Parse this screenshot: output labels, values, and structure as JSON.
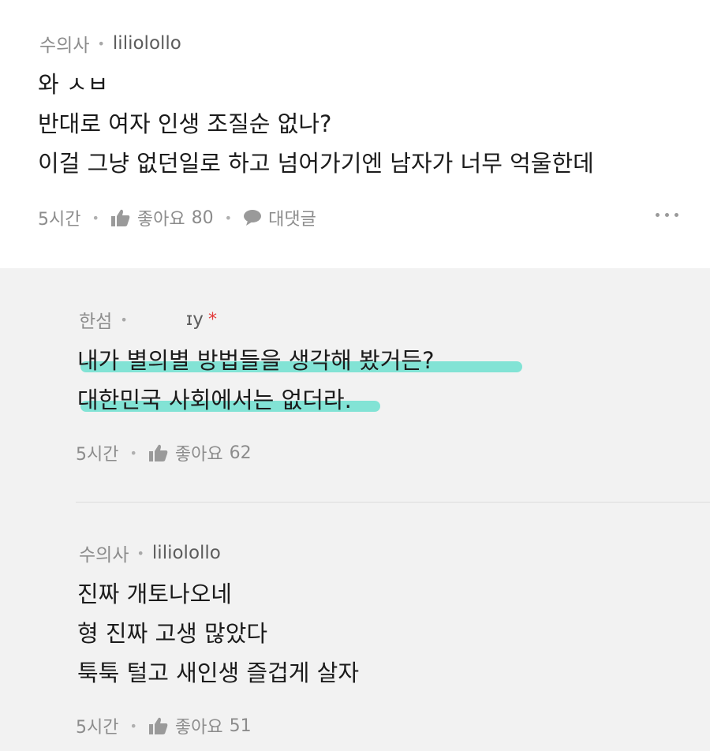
{
  "comment": {
    "tag": "수의사",
    "user": "liliolollo",
    "lines": [
      "와 ㅅㅂ",
      "반대로 여자 인생 조질순 없나?",
      "이걸 그냥 없던일로 하고 넘어가기엔 남자가 너무 억울한데"
    ],
    "time": "5시간",
    "like_label": "좋아요",
    "like_count": "80",
    "reply_label": "대댓글"
  },
  "reply1": {
    "tag": "한섬",
    "user_fragment": "ɪy",
    "lines": [
      "내가 별의별 방법들을 생각해 봤거든?",
      "대한민국 사회에서는 없더라."
    ],
    "time": "5시간",
    "like_label": "좋아요",
    "like_count": "62"
  },
  "reply2": {
    "tag": "수의사",
    "user": "liliolollo",
    "lines": [
      "진짜 개토나오네",
      "형 진짜 고생 많았다",
      "툭툭 털고 새인생 즐겁게 살자"
    ],
    "time": "5시간",
    "like_label": "좋아요",
    "like_count": "51"
  },
  "colors": {
    "highlight": "#6fe0d0",
    "reply_bg": "#f2f2f2",
    "meta_text": "#8c8c8c",
    "author_mark": "#e23b3b"
  },
  "icons": [
    "thumbs-up-icon",
    "speech-bubble-icon",
    "more-dots-icon"
  ]
}
